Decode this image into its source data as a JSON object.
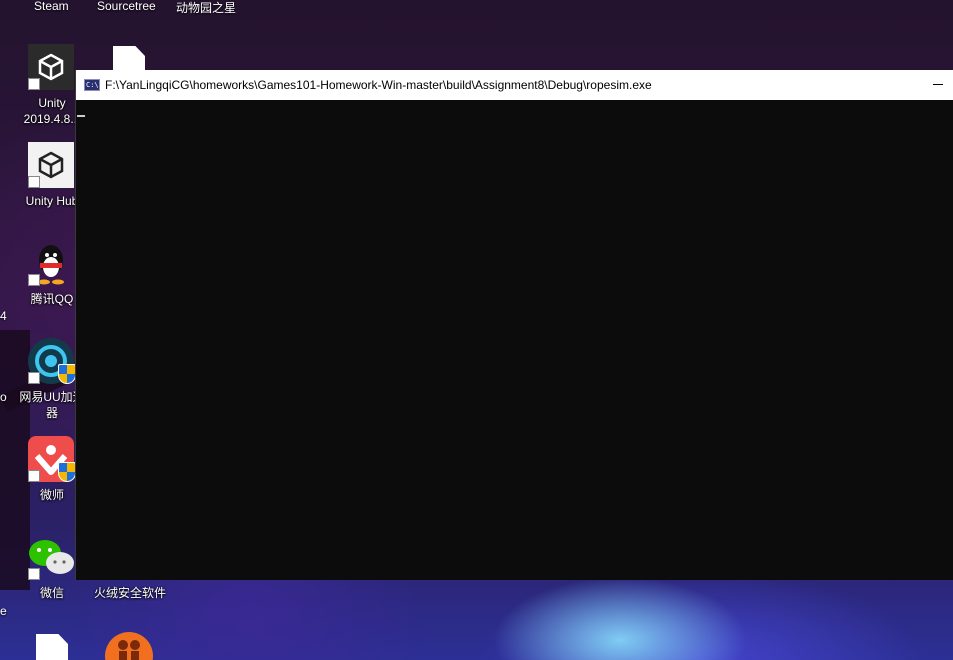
{
  "desktop": {
    "top_labels": [
      "Steam",
      "Sourcetree",
      "动物园之星"
    ],
    "icons": [
      {
        "label_line1": "Unity",
        "label_line2": "2019.4.8...",
        "icon": "unity-icon"
      },
      {
        "label_line1": "Unity Hub",
        "icon": "unity-hub-icon"
      },
      {
        "label_line1": "腾讯QQ",
        "icon": "qq-penguin-icon"
      },
      {
        "label_line1": "网易UU加速",
        "label_line2": "器",
        "icon": "netease-uu-icon"
      },
      {
        "label_line1": "微师",
        "icon": "weishi-icon"
      },
      {
        "label_line1": "微信",
        "icon": "wechat-icon"
      },
      {
        "label_line1": "火绒安全软件",
        "icon": "huorong-icon"
      }
    ],
    "edge_texts": [
      "4",
      "o",
      "e"
    ]
  },
  "console": {
    "app_icon_text": "C:\\",
    "title": "F:\\YanLingqiCG\\homeworks\\Games101-Homework-Win-master\\build\\Assignment8\\Debug\\ropesim.exe",
    "minimize_icon": "minimize-icon",
    "background": "#0c0c0c"
  },
  "colors": {
    "console_bg": "#0c0c0c",
    "titlebar_bg": "#ffffff",
    "unity_tile": "#2b2b2b",
    "wechat_green": "#2dc100",
    "weishi_red": "#ef4c4c",
    "huorong_orange": "#f07020"
  }
}
